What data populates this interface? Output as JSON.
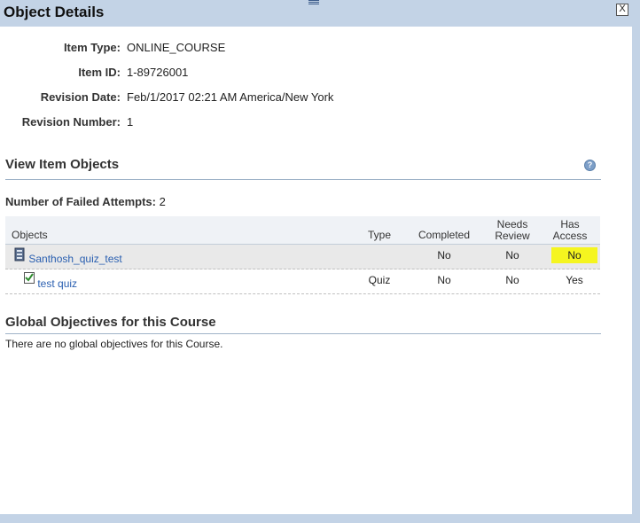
{
  "dialog": {
    "title": "Object Details",
    "close_label": "X"
  },
  "details": [
    {
      "label": "Item Type:",
      "value": "ONLINE_COURSE"
    },
    {
      "label": "Item ID:",
      "value": "1-89726001"
    },
    {
      "label": "Revision Date:",
      "value": "Feb/1/2017 02:21 AM America/New York"
    },
    {
      "label": "Revision Number:",
      "value": "1"
    }
  ],
  "view_objects": {
    "title": "View Item Objects",
    "help_icon": "question-icon"
  },
  "failed_attempts": {
    "label": "Number of Failed Attempts:",
    "value": "2"
  },
  "table": {
    "headers": {
      "objects": "Objects",
      "type": "Type",
      "completed": "Completed",
      "needs_review_1": "Needs",
      "needs_review_2": "Review",
      "has_access_1": "Has",
      "has_access_2": "Access"
    },
    "rows": [
      {
        "name": "Santhosh_quiz_test",
        "type": "",
        "completed": "No",
        "needs_review": "No",
        "has_access": "No",
        "icon": "course-icon"
      },
      {
        "name": "test quiz",
        "type": "Quiz",
        "completed": "No",
        "needs_review": "No",
        "has_access": "Yes",
        "icon": "quiz-checkbox-icon"
      }
    ],
    "highlight_color": "#f5f51f"
  },
  "global_objectives": {
    "title": "Global Objectives for this Course",
    "message": "There are no global objectives for this Course."
  }
}
